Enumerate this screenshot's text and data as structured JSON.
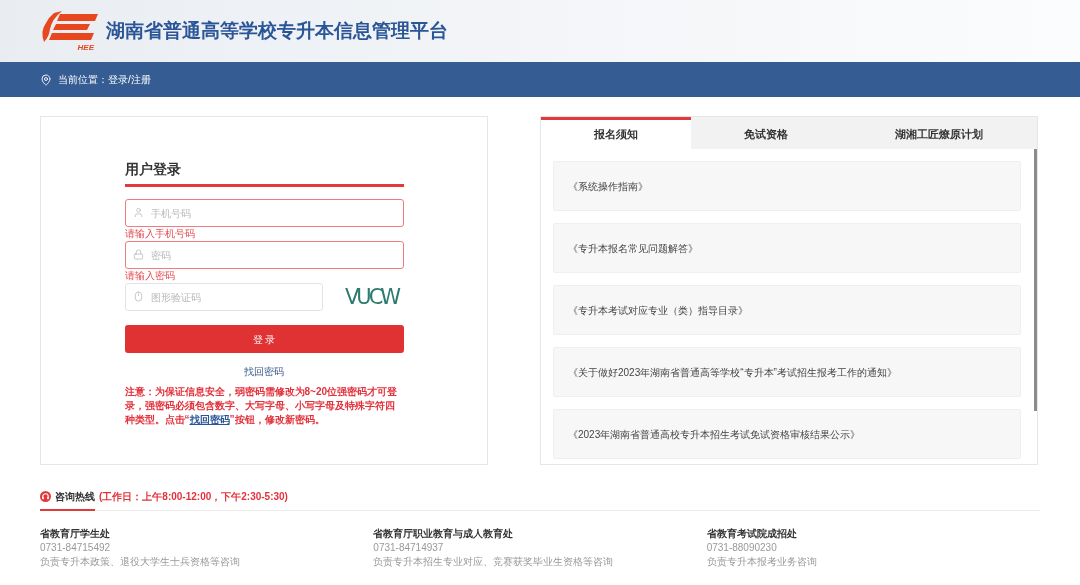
{
  "header": {
    "logo_text": "HEE",
    "title": "湖南省普通高等学校专升本信息管理平台"
  },
  "breadcrumb": {
    "label": "当前位置：",
    "path": "登录/注册"
  },
  "login": {
    "title": "用户登录",
    "fields": [
      {
        "kind": "phone",
        "placeholder": "手机号码",
        "invalid": true,
        "error": "请输入手机号码"
      },
      {
        "kind": "password",
        "placeholder": "密码",
        "invalid": true,
        "error": "请输入密码"
      },
      {
        "kind": "captcha",
        "placeholder": "图形验证码",
        "invalid": false,
        "captcha_text": "VUCW"
      }
    ],
    "submit": "登 录",
    "forgot_link": "找回密码",
    "notice": {
      "before": "注意：为保证信息安全，弱密码需修改为8~20位强密码才可登录，强密码必须包含数字、大写字母、小写字母及特殊字符四种类型。点击“",
      "link": "找回密码",
      "after": "”按钮，修改新密码。"
    }
  },
  "tabs": [
    {
      "label": "报名须知",
      "selected": true
    },
    {
      "label": "免试资格",
      "selected": false
    },
    {
      "label": "湖湘工匠燎原计划",
      "selected": false
    }
  ],
  "notices": [
    "《系统操作指南》",
    "《专升本报名常见问题解答》",
    "《专升本考试对应专业（类）指导目录》",
    "《关于做好2023年湖南省普通高等学校“专升本”考试招生报考工作的通知》",
    "《2023年湖南省普通高校专升本招生考试免试资格审核结果公示》"
  ],
  "hotline": {
    "title": "咨询热线",
    "hours": "(工作日：上午8:00-12:00，下午2:30-5:30)"
  },
  "contacts": [
    {
      "name": "省教育厅学生处",
      "phone": "0731-84715492",
      "desc": "负责专升本政策、退役大学生士兵资格等咨询"
    },
    {
      "name": "省教育厅职业教育与成人教育处",
      "phone": "0731-84714937",
      "desc": "负责专升本招生专业对应、竞赛获奖毕业生资格等咨询"
    },
    {
      "name": "省教育考试院成招处",
      "phone": "0731-88090230",
      "desc": "负责专升本报考业务咨询"
    }
  ]
}
